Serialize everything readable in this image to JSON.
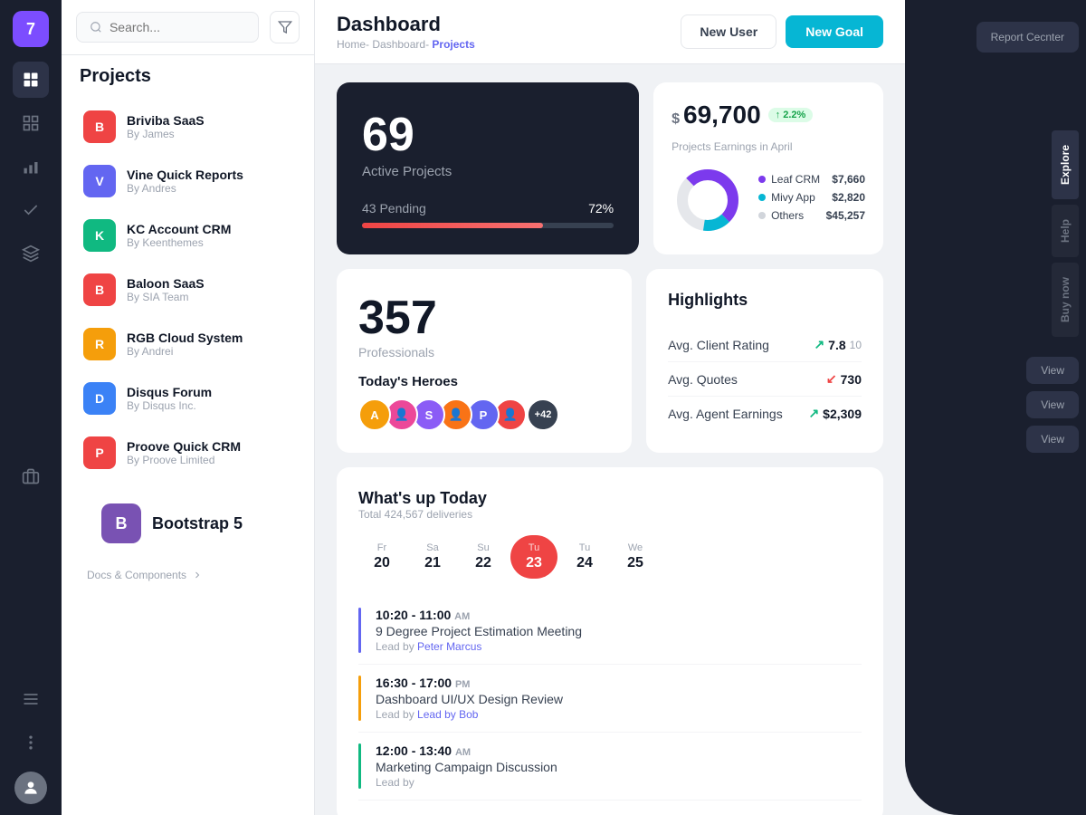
{
  "sidebar": {
    "avatar_number": "7",
    "icons": [
      "grid",
      "bars",
      "check",
      "layers",
      "briefcase"
    ]
  },
  "projects_panel": {
    "title": "Projects",
    "items": [
      {
        "name": "Briviba SaaS",
        "by": "By James",
        "color": "#ef4444",
        "letter": "B"
      },
      {
        "name": "Vine Quick Reports",
        "by": "By Andres",
        "color": "#6366f1",
        "letter": "V"
      },
      {
        "name": "KC Account CRM",
        "by": "By Keenthemes",
        "color": "#10b981",
        "letter": "K"
      },
      {
        "name": "Baloon SaaS",
        "by": "By SIA Team",
        "color": "#ef4444",
        "letter": "B"
      },
      {
        "name": "RGB Cloud System",
        "by": "By Andrei",
        "color": "#f59e0b",
        "letter": "R"
      },
      {
        "name": "Disqus Forum",
        "by": "By Disqus Inc.",
        "color": "#3b82f6",
        "letter": "D"
      },
      {
        "name": "Proove Quick CRM",
        "by": "By Proove Limited",
        "color": "#ef4444",
        "letter": "P"
      }
    ],
    "bootstrap_label": "Bootstrap 5"
  },
  "topbar": {
    "search_placeholder": "Search..."
  },
  "header": {
    "title": "Dashboard",
    "breadcrumb_home": "Home-",
    "breadcrumb_dashboard": "Dashboard-",
    "breadcrumb_active": "Projects",
    "new_user_label": "New User",
    "new_goal_label": "New Goal"
  },
  "active_projects": {
    "number": "69",
    "label": "Active Projects",
    "pending_label": "43 Pending",
    "percent": "72%",
    "progress_width": "72"
  },
  "earnings": {
    "dollar": "$",
    "amount": "69,700",
    "badge": "↑ 2.2%",
    "label": "Projects Earnings in April",
    "legend": [
      {
        "name": "Leaf CRM",
        "color": "#7c3aed",
        "value": "$7,660"
      },
      {
        "name": "Mivy App",
        "color": "#06b6d4",
        "value": "$2,820"
      },
      {
        "name": "Others",
        "color": "#d1d5db",
        "value": "$45,257"
      }
    ]
  },
  "professionals": {
    "number": "357",
    "label": "Professionals",
    "heroes_label": "Today's Heroes",
    "avatars": [
      {
        "letter": "A",
        "color": "#f59e0b"
      },
      {
        "color": "#ec4899",
        "img": true
      },
      {
        "letter": "S",
        "color": "#8b5cf6"
      },
      {
        "color": "#f97316",
        "img": true
      },
      {
        "letter": "P",
        "color": "#6366f1"
      },
      {
        "color": "#ef4444",
        "img": true
      }
    ],
    "more": "+42"
  },
  "highlights": {
    "title": "Highlights",
    "items": [
      {
        "name": "Avg. Client Rating",
        "value": "7.8",
        "extra": "10",
        "trend": "up"
      },
      {
        "name": "Avg. Quotes",
        "value": "730",
        "trend": "down"
      },
      {
        "name": "Avg. Agent Earnings",
        "value": "$2,309",
        "trend": "up"
      }
    ]
  },
  "whatsup": {
    "title": "What's up Today",
    "subtitle": "Total 424,567 deliveries",
    "days": [
      {
        "name": "Fr",
        "num": "20"
      },
      {
        "name": "Sa",
        "num": "21"
      },
      {
        "name": "Su",
        "num": "22"
      },
      {
        "name": "Tu",
        "num": "23",
        "active": true
      },
      {
        "name": "Tu",
        "num": "24"
      },
      {
        "name": "We",
        "num": "25"
      }
    ],
    "events": [
      {
        "time": "10:20 - 11:00",
        "ampm": "AM",
        "name": "9 Degree Project Estimation Meeting",
        "lead_text": "Lead by",
        "lead_name": "Peter Marcus",
        "bar_color": "#6366f1"
      },
      {
        "time": "16:30 - 17:00",
        "ampm": "PM",
        "name": "Dashboard UI/UX Design Review",
        "lead_text": "Lead by",
        "lead_name": "Lead by Bob",
        "bar_color": "#f59e0b"
      },
      {
        "time": "12:00 - 13:40",
        "ampm": "AM",
        "name": "Marketing Campaign Discussion",
        "lead_text": "Lead by",
        "lead_name": "",
        "bar_color": "#10b981"
      }
    ]
  },
  "right_panel": {
    "tabs": [
      "Explore",
      "Help",
      "Buy now"
    ],
    "report_center_label": "Report Cecnter",
    "view_label": "View"
  }
}
